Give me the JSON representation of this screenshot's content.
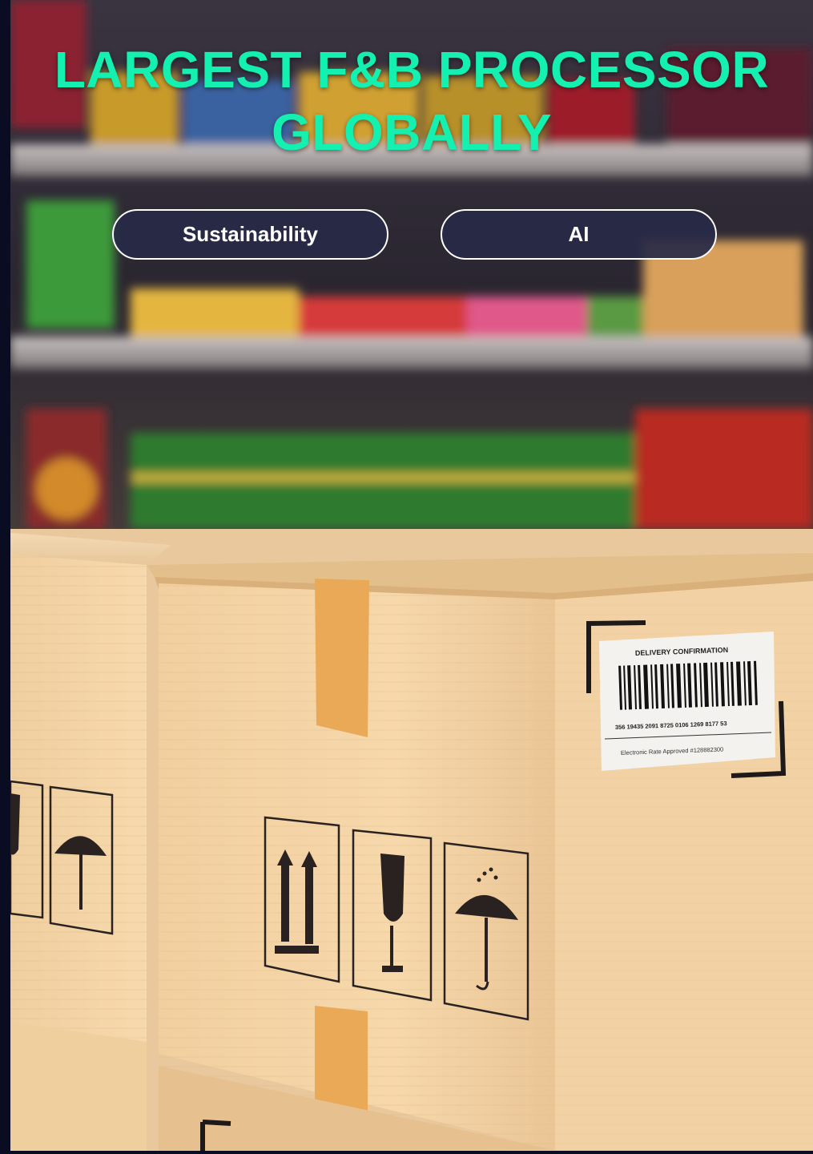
{
  "headline": {
    "line1": "LARGEST F&B PROCESSOR",
    "line2": "GLOBALLY"
  },
  "buttons": [
    {
      "label": "Sustainability"
    },
    {
      "label": "AI"
    }
  ],
  "photo": {
    "label_title": "DELIVERY CONFIRMATION",
    "barcode_number": "356 19435 2091 8725 0106 1269 8177 53",
    "label_footer": "Electronic Rate Approved #128882300"
  },
  "colors": {
    "headline": "#14f0b0",
    "pill_bg": "#282a46",
    "pill_border": "#ffffff",
    "frame": "#0b0e24"
  }
}
